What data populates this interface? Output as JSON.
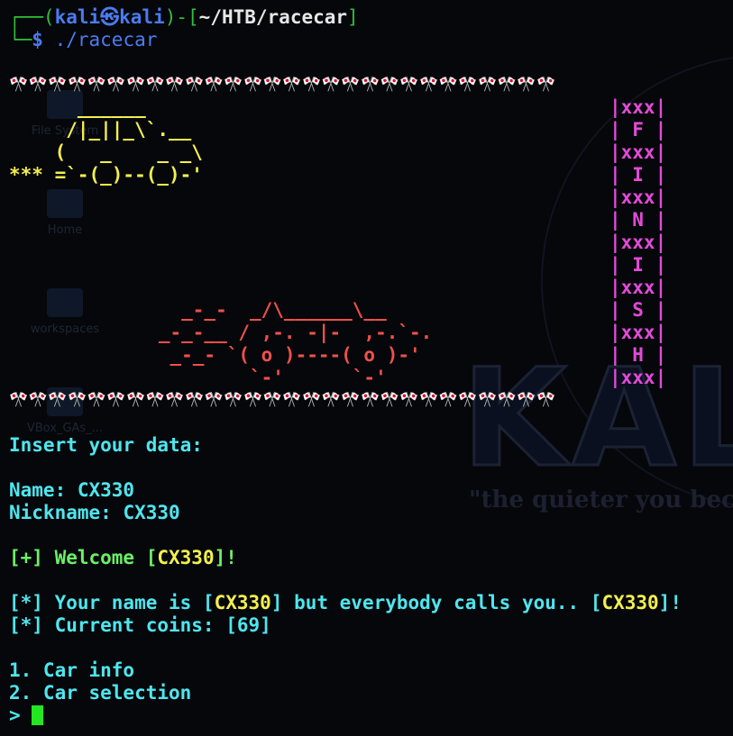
{
  "prompt": {
    "frame_open": "┌──(",
    "user": "kali㉿kali",
    "frame_mid": ")-[",
    "path": "~/HTB/racecar",
    "frame_close": "]",
    "frame_second": "└─",
    "dollar": "$",
    "command": " ./racecar"
  },
  "desktop": {
    "icons": [
      "File System",
      "Home",
      "workspaces",
      "VBox_GAs_..."
    ],
    "logo": "KALI",
    "tagline": "\"the quieter you become"
  },
  "banner": {
    "flag_row": "🎌🎌🎌🎌🎌🎌🎌🎌🎌🎌🎌🎌🎌🎌🎌🎌🎌🎌🎌🎌🎌🎌🎌🎌🎌🎌🎌🎌",
    "yellow_car": "      ______\n     /|_||_\\`.__\n    (   _    _ _\\\n*** =`-(_)--(_)-'",
    "red_car": "        _-_-  _/\\______\\__\n      _-_-__ / ,-. -|-  ,-.`-.\n       _-_- `( o )----( o )-'\n              `-'      `-'",
    "finish_column": "|xxx|\n| F |\n|xxx|\n| I |\n|xxx|\n| N |\n|xxx|\n| I |\n|xxx|\n| S |\n|xxx|\n| H |\n|xxx|"
  },
  "output": {
    "insert_prompt": "Insert your data:",
    "name_label": "Name: ",
    "name_value": "CX330",
    "nickname_label": "Nickname: ",
    "nickname_value": "CX330",
    "welcome_prefix": "[+] Welcome [",
    "welcome_name": "CX330",
    "welcome_suffix": "]!",
    "yourname_prefix": "[*] Your name is [",
    "yourname_name": "CX330",
    "yourname_middle": "] but everybody calls you.. [",
    "yourname_nick": "CX330",
    "yourname_suffix": "]!",
    "coins_line": "[*] Current coins: [69]",
    "menu": [
      "1. Car info",
      "2. Car selection"
    ],
    "input_prompt": "> "
  },
  "colors": {
    "background": "#06070b",
    "cyan": "#4ee6ee",
    "green": "#6cf067",
    "yellow": "#f3ef4e",
    "red": "#f0504a",
    "magenta": "#e24bd8",
    "cursor": "#22e622"
  }
}
